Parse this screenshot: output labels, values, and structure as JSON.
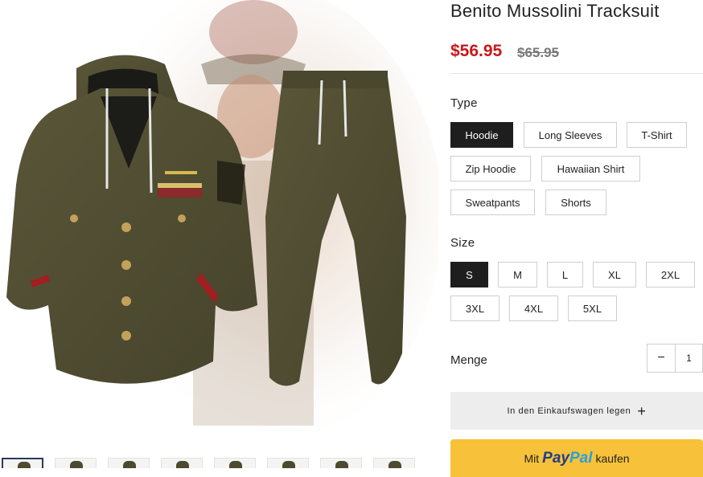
{
  "product": {
    "title": "Benito Mussolini Tracksuit",
    "price": "$56.95",
    "compare_price": "$65.95"
  },
  "type_option": {
    "label": "Type",
    "selected": "Hoodie",
    "values": [
      "Hoodie",
      "Long Sleeves",
      "T-Shirt",
      "Zip Hoodie",
      "Hawaiian Shirt",
      "Sweatpants",
      "Shorts"
    ]
  },
  "size_option": {
    "label": "Size",
    "selected": "S",
    "values": [
      "S",
      "M",
      "L",
      "XL",
      "2XL",
      "3XL",
      "4XL",
      "5XL"
    ]
  },
  "quantity": {
    "label": "Menge",
    "minus": "−",
    "value": "1"
  },
  "cart_button": {
    "label": "In den Einkaufswagen legen",
    "icon": "plus-icon"
  },
  "paypal_button": {
    "prefix": "Mit",
    "brand_1": "Pay",
    "brand_2": "Pal",
    "suffix": "kaufen"
  },
  "gallery": {
    "thumbnail_count": 8,
    "active_index": 0
  },
  "colors": {
    "price": "#c8171b",
    "selected_option_bg": "#1e1e1e",
    "paypal_bg": "#f7c23a",
    "garment_olive": "#4f4c32"
  }
}
